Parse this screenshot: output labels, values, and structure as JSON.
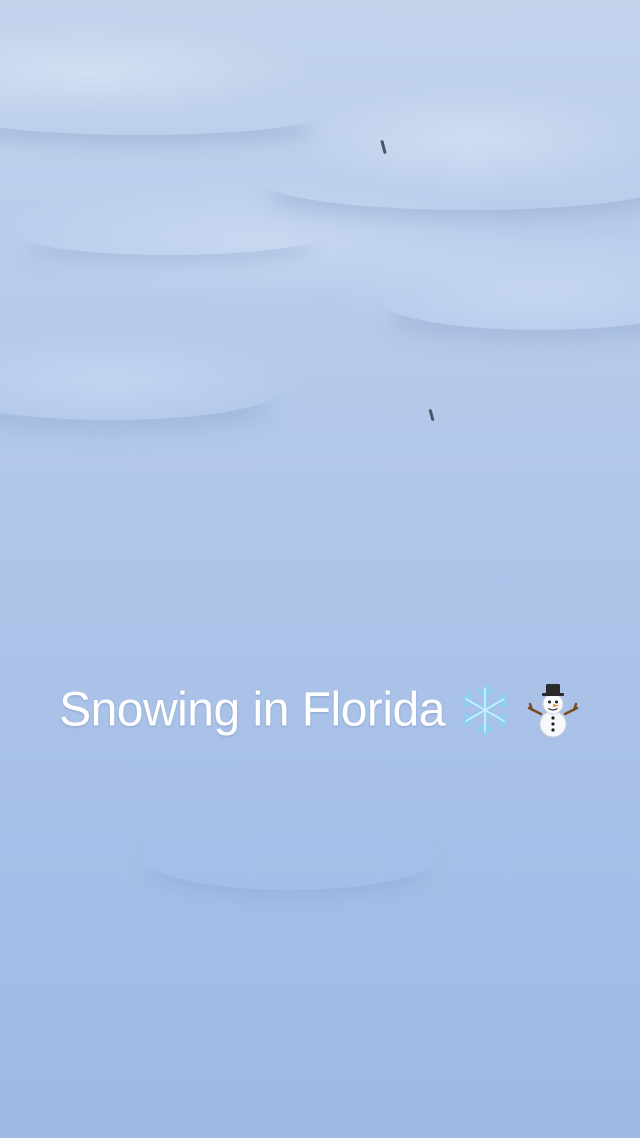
{
  "caption": {
    "text": "Snowing in Florida",
    "icons": [
      "snowflake-icon",
      "snowman-icon"
    ]
  },
  "colors": {
    "snow_light": "#c3d3ec",
    "snow_shadow": "#9fb9e6",
    "caption_text": "#ffffff"
  }
}
